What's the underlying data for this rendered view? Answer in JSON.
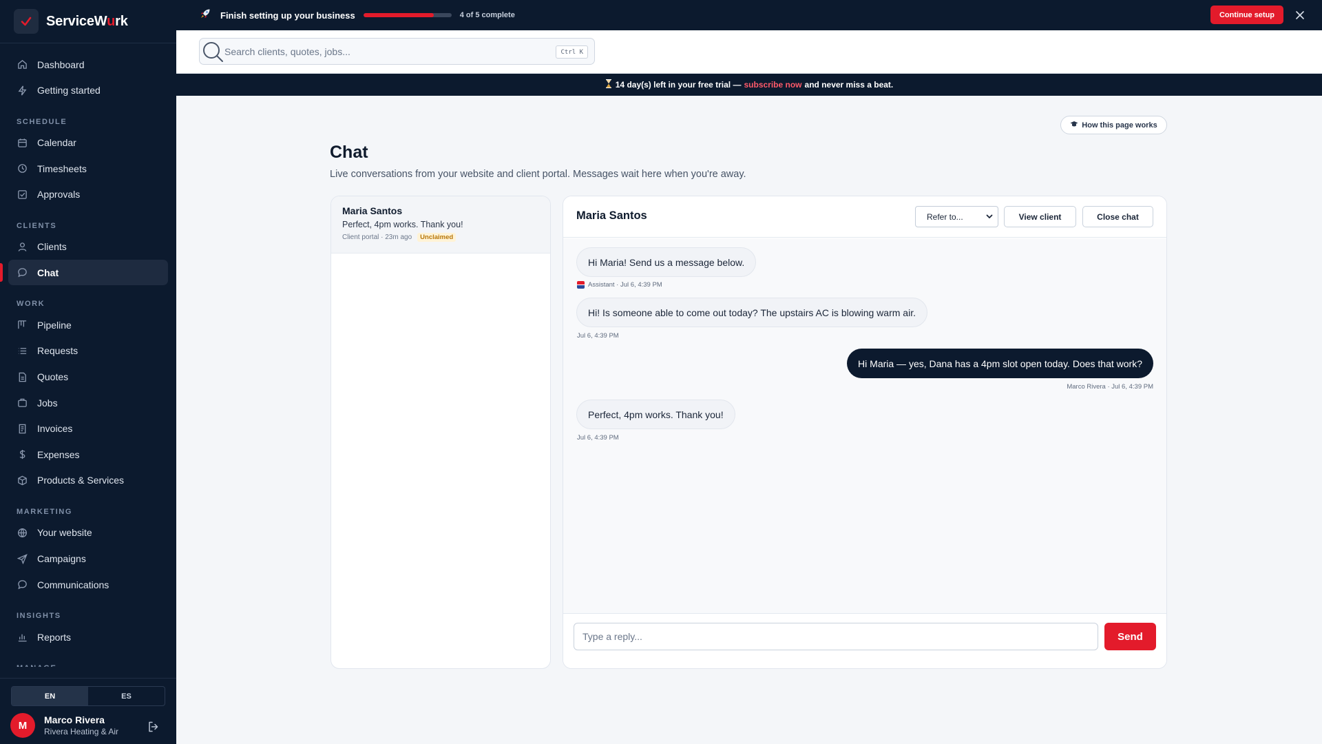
{
  "app": {
    "brand_prefix": "ServiceW",
    "brand_accent": "u",
    "brand_suffix": "rk",
    "brand_color": "#e31b2b"
  },
  "sidebar": {
    "top_items": [
      {
        "label": "Dashboard",
        "icon": "home-icon"
      },
      {
        "label": "Getting started",
        "icon": "bolt-icon"
      }
    ],
    "sections": [
      {
        "title": "SCHEDULE",
        "items": [
          {
            "label": "Calendar",
            "icon": "calendar-icon"
          },
          {
            "label": "Timesheets",
            "icon": "clock-icon"
          },
          {
            "label": "Approvals",
            "icon": "check-square-icon"
          }
        ]
      },
      {
        "title": "CLIENTS",
        "items": [
          {
            "label": "Clients",
            "icon": "user-icon"
          },
          {
            "label": "Chat",
            "icon": "chat-icon",
            "active": true
          }
        ]
      },
      {
        "title": "WORK",
        "items": [
          {
            "label": "Pipeline",
            "icon": "pipeline-icon"
          },
          {
            "label": "Requests",
            "icon": "list-icon"
          },
          {
            "label": "Quotes",
            "icon": "document-icon"
          },
          {
            "label": "Jobs",
            "icon": "briefcase-icon"
          },
          {
            "label": "Invoices",
            "icon": "invoice-icon"
          },
          {
            "label": "Expenses",
            "icon": "dollar-icon"
          },
          {
            "label": "Products & Services",
            "icon": "box-icon"
          }
        ]
      },
      {
        "title": "MARKETING",
        "items": [
          {
            "label": "Your website",
            "icon": "globe-icon"
          },
          {
            "label": "Campaigns",
            "icon": "send-icon"
          },
          {
            "label": "Communications",
            "icon": "message-icon"
          }
        ]
      },
      {
        "title": "INSIGHTS",
        "items": [
          {
            "label": "Reports",
            "icon": "bar-chart-icon"
          }
        ]
      },
      {
        "title": "MANAGE",
        "items": []
      }
    ],
    "languages": [
      "EN",
      "ES"
    ],
    "selected_language": "EN",
    "user": {
      "initial": "M",
      "name": "Marco Rivera",
      "org": "Rivera Heating & Air"
    }
  },
  "setup": {
    "title": "Finish setting up your business",
    "progress": 0.8,
    "count_label": "4 of 5 complete",
    "button": "Continue setup"
  },
  "search": {
    "placeholder": "Search clients, quotes, jobs...",
    "shortcut": "Ctrl K"
  },
  "trial": {
    "days": "14",
    "text_before": "day(s) left in your free trial —",
    "link": "subscribe now",
    "text_after": "and never miss a beat."
  },
  "page": {
    "help_button": "How this page works",
    "title": "Chat",
    "subtitle": "Live conversations from your website and client portal. Messages wait here when you're away."
  },
  "conversations": [
    {
      "name": "Maria Santos",
      "last_message": "Perfect, 4pm works. Thank you!",
      "meta": "Client portal · 23m ago",
      "badge": "Unclaimed"
    }
  ],
  "chat": {
    "title": "Maria Santos",
    "refer_placeholder": "Refer to...",
    "view_client": "View client",
    "close_chat": "Close chat",
    "messages": [
      {
        "direction": "in",
        "text": "Hi Maria! Send us a message below.",
        "meta": "Assistant · Jul 6, 4:39 PM"
      },
      {
        "direction": "in",
        "text": "Hi! Is someone able to come out today? The upstairs AC is blowing warm air.",
        "meta": "Jul 6, 4:39 PM"
      },
      {
        "direction": "out",
        "text": "Hi Maria — yes, Dana has a 4pm slot open today. Does that work?",
        "meta": "Marco Rivera · Jul 6, 4:39 PM"
      },
      {
        "direction": "in",
        "text": "Perfect, 4pm works. Thank you!",
        "meta": "Jul 6, 4:39 PM"
      }
    ],
    "reply_placeholder": "Type a reply...",
    "send": "Send"
  }
}
